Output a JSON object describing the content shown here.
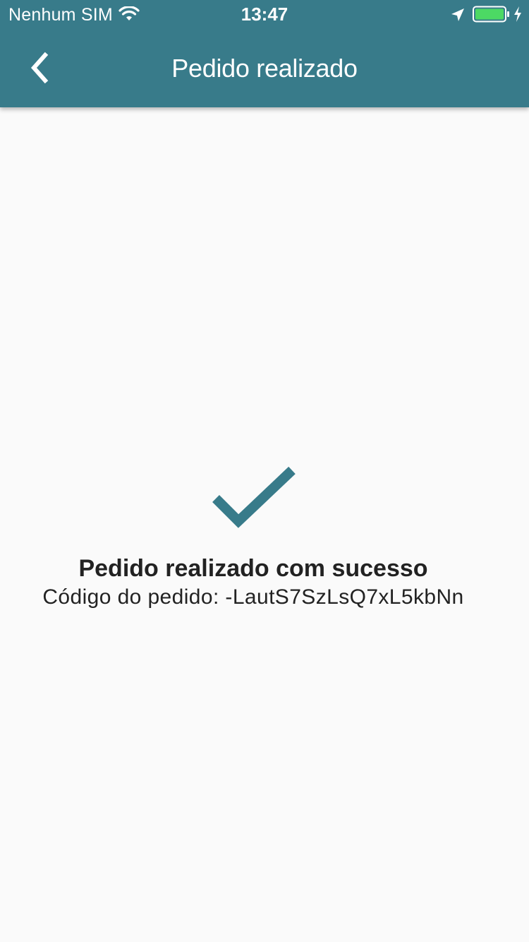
{
  "status_bar": {
    "carrier": "Nenhum SIM",
    "time": "13:47",
    "icons": [
      "wifi-icon",
      "location-arrow-icon",
      "battery-icon",
      "charging-bolt-icon"
    ]
  },
  "header": {
    "title": "Pedido realizado",
    "back_icon": "chevron-left-icon"
  },
  "main": {
    "status_icon": "checkmark-icon",
    "success_message": "Pedido realizado com sucesso",
    "order_code": "Código do pedido: -LautS7SzLsQ7xL5kbNn"
  },
  "colors": {
    "primary": "#387b8a",
    "background": "#fafafa",
    "text": "#222222",
    "battery_fill": "#4cd964"
  }
}
